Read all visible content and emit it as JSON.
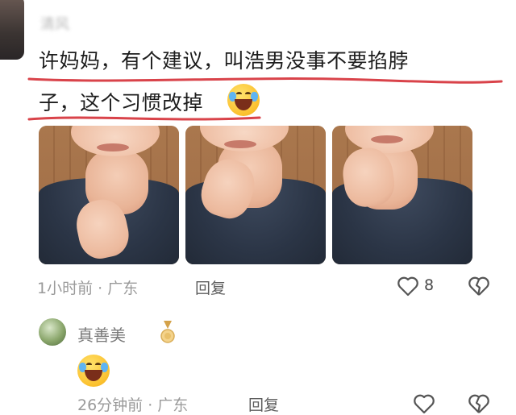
{
  "comment": {
    "author_blurred": "清风",
    "line1": "许妈妈，有个建议，叫浩男没事不要掐脖",
    "line2": "子，这个习惯改掉",
    "emoji": "laughing-crying-emoji",
    "photos": [
      "photo-neck-hand-1",
      "photo-neck-hand-2",
      "photo-neck-hand-3"
    ],
    "time_location": "1小时前 · 广东",
    "reply_label": "回复",
    "like_count": "8",
    "underline_color": "#d9434a"
  },
  "reply": {
    "username": "真善美",
    "badge": "medal-icon",
    "emoji": "laughing-crying-emoji",
    "time_location": "26分钟前 · 广东",
    "reply_label": "回复"
  },
  "icons": {
    "like": "heart-outline-icon",
    "dislike": "broken-heart-icon"
  }
}
